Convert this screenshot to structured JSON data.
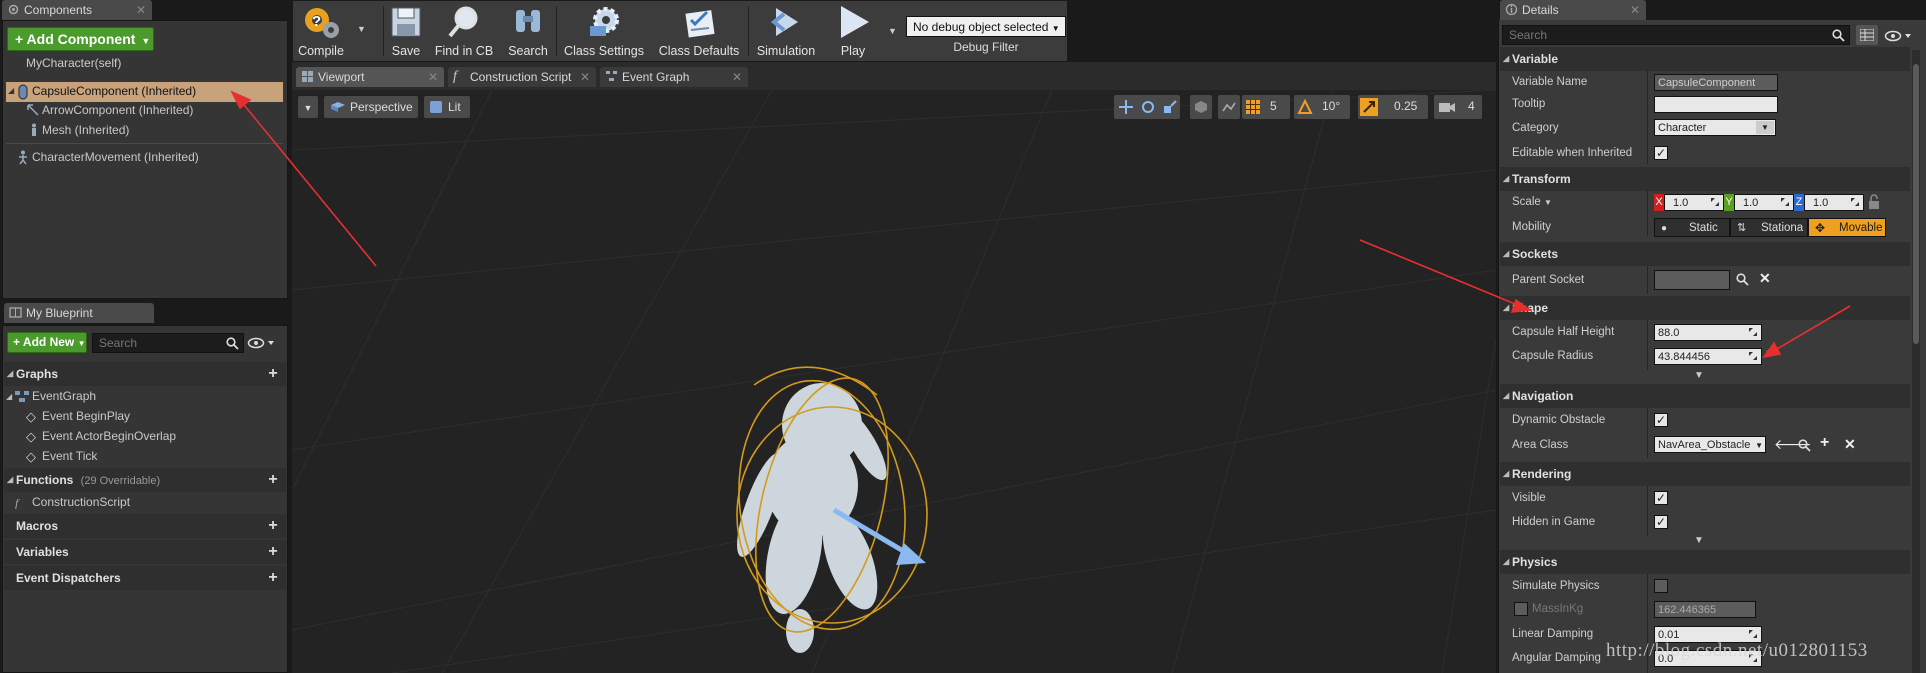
{
  "components_panel": {
    "tab_label": "Components",
    "add_button": "+ Add Component",
    "self_label": "MyCharacter(self)",
    "items": [
      {
        "label": "CapsuleComponent (Inherited)"
      },
      {
        "label": "ArrowComponent (Inherited)"
      },
      {
        "label": "Mesh (Inherited)"
      },
      {
        "label": "CharacterMovement (Inherited)"
      }
    ]
  },
  "blueprint_panel": {
    "tab_label": "My Blueprint",
    "add_new": "Add New",
    "search_placeholder": "Search",
    "graphs_label": "Graphs",
    "event_graph": "EventGraph",
    "events": [
      "Event BeginPlay",
      "Event ActorBeginOverlap",
      "Event Tick"
    ],
    "functions_label": "Functions",
    "functions_count": "(29 Overridable)",
    "construction_script": "ConstructionScript",
    "macros_label": "Macros",
    "variables_label": "Variables",
    "dispatchers_label": "Event Dispatchers"
  },
  "toolbar": {
    "compile": "Compile",
    "save": "Save",
    "find_in_cb": "Find in CB",
    "search": "Search",
    "class_settings": "Class Settings",
    "class_defaults": "Class Defaults",
    "simulation": "Simulation",
    "play": "Play",
    "debug_select": "No debug object selected",
    "debug_filter": "Debug Filter"
  },
  "editor_tabs": {
    "viewport": "Viewport",
    "construction_script": "Construction Script",
    "event_graph": "Event Graph"
  },
  "viewport": {
    "perspective": "Perspective",
    "lit": "Lit",
    "grid_snap": "5",
    "rotation_snap": "10°",
    "scale_snap": "0.25",
    "camera_speed": "4"
  },
  "details": {
    "tab_label": "Details",
    "search_placeholder": "Search",
    "variable_section": "Variable",
    "variable_name_label": "Variable Name",
    "variable_name_value": "CapsuleComponent",
    "tooltip_label": "Tooltip",
    "tooltip_value": "",
    "category_label": "Category",
    "category_value": "Character",
    "editable_label": "Editable when Inherited",
    "transform_section": "Transform",
    "scale_label": "Scale",
    "scale_x": "1.0",
    "scale_y": "1.0",
    "scale_z": "1.0",
    "axis_x": "X",
    "axis_y": "Y",
    "axis_z": "Z",
    "mobility_label": "Mobility",
    "mobility_static": "Static",
    "mobility_stationary": "Stationa",
    "mobility_movable": "Movable",
    "sockets_section": "Sockets",
    "parent_socket_label": "Parent Socket",
    "shape_section": "Shape",
    "half_height_label": "Capsule Half Height",
    "half_height_value": "88.0",
    "radius_label": "Capsule Radius",
    "radius_value": "43.844456",
    "navigation_section": "Navigation",
    "dynamic_obstacle_label": "Dynamic Obstacle",
    "area_class_label": "Area Class",
    "area_class_value": "NavArea_Obstacle",
    "rendering_section": "Rendering",
    "visible_label": "Visible",
    "hidden_label": "Hidden in Game",
    "physics_section": "Physics",
    "simulate_label": "Simulate Physics",
    "mass_label": "MassInKg",
    "mass_value": "162.446365",
    "linear_damping_label": "Linear Damping",
    "linear_damping_value": "0.01",
    "angular_damping_label": "Angular Damping",
    "angular_damping_value": "0.0"
  },
  "watermark": "http://blog.csdn.net/u012801153",
  "colors": {
    "accent_orange": "#f0a020",
    "selection": "#c8a27a",
    "green_button": "#4a9a2c",
    "arrow_red": "#e53030",
    "capsule": "#d49a1c"
  }
}
